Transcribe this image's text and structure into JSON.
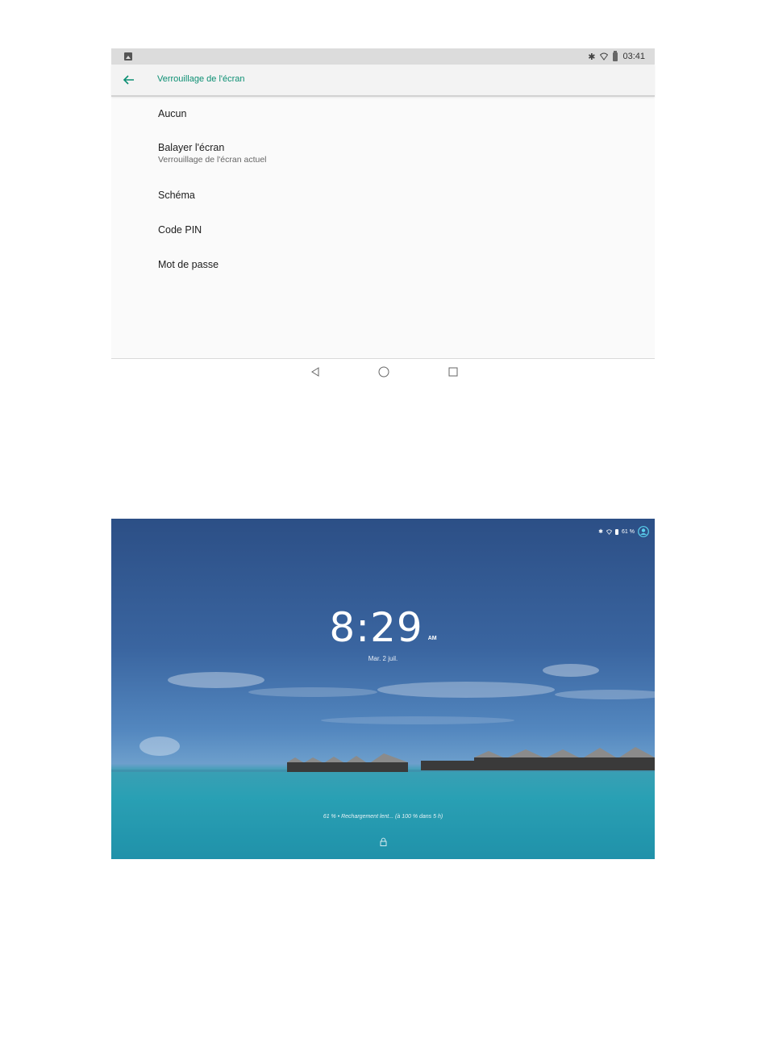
{
  "settings_screen": {
    "status_bar": {
      "time": "03:41",
      "icons": [
        "gallery-icon",
        "bluetooth-icon",
        "wifi-icon",
        "battery-icon"
      ]
    },
    "app_bar": {
      "title": "Verrouillage de l'écran",
      "back_icon": "arrow-left-icon"
    },
    "options": [
      {
        "label": "Aucun",
        "sublabel": ""
      },
      {
        "label": "Balayer l'écran",
        "sublabel": "Verrouillage de l'écran actuel"
      },
      {
        "label": "Schéma",
        "sublabel": ""
      },
      {
        "label": "Code PIN",
        "sublabel": ""
      },
      {
        "label": "Mot de passe",
        "sublabel": ""
      }
    ],
    "nav_bar": {
      "buttons": [
        "back-triangle-icon",
        "home-circle-icon",
        "recents-square-icon"
      ]
    },
    "accent_color": "#0c8f73"
  },
  "lock_screen": {
    "status": {
      "battery": "61 %",
      "icons": [
        "bluetooth-icon",
        "wifi-icon",
        "battery-icon",
        "user-avatar-icon"
      ]
    },
    "clock": {
      "time": "8:29",
      "ampm": "AM"
    },
    "date": "Mar. 2 juil.",
    "charging_text": "61 % • Rechargement lent... (à 100 % dans 5 h)",
    "lock_icon": "lock-icon"
  }
}
